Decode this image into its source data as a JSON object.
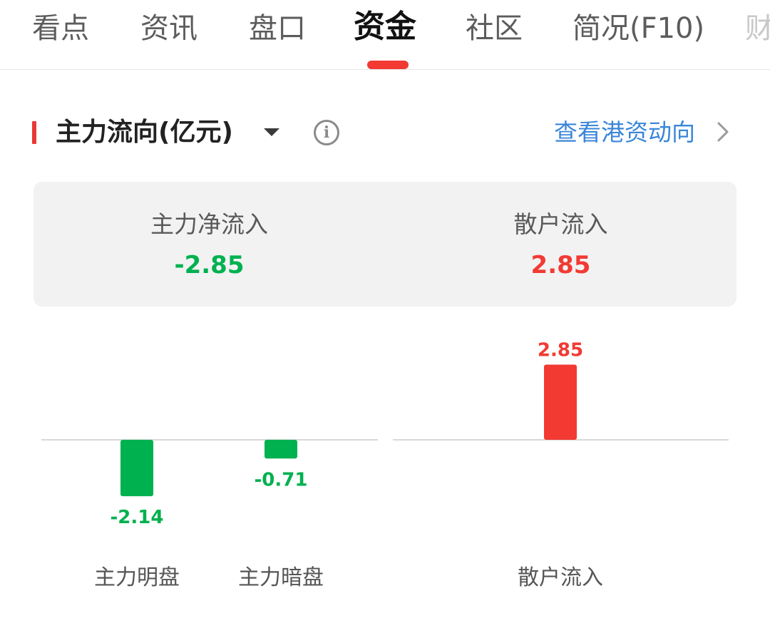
{
  "tabs": [
    {
      "label": "看点",
      "active": false
    },
    {
      "label": "资讯",
      "active": false
    },
    {
      "label": "盘口",
      "active": false
    },
    {
      "label": "资金",
      "active": true
    },
    {
      "label": "社区",
      "active": false
    },
    {
      "label": "简况(F10)",
      "active": false
    },
    {
      "label": "财",
      "active": false
    }
  ],
  "section": {
    "title": "主力流向(亿元)",
    "caret_icon": "triangle-down-icon",
    "info_icon": "info-icon",
    "link_label": "查看港资动向",
    "link_icon": "chevron-right-icon"
  },
  "summary": {
    "main_net_label": "主力净流入",
    "main_net_value": "-2.85",
    "retail_label": "散户流入",
    "retail_value": "2.85"
  },
  "colors": {
    "positive": "#f23a33",
    "negative": "#00b14f",
    "accent": "#f23a33",
    "link": "#3b86d9"
  },
  "chart_data": [
    {
      "type": "bar",
      "categories": [
        "主力明盘",
        "主力暗盘"
      ],
      "values": [
        -2.14,
        -0.71
      ],
      "data_labels": [
        "-2.14",
        "-0.71"
      ],
      "baseline": 0
    },
    {
      "type": "bar",
      "categories": [
        "散户流入"
      ],
      "values": [
        2.85
      ],
      "data_labels": [
        "2.85"
      ],
      "baseline": 0
    }
  ]
}
